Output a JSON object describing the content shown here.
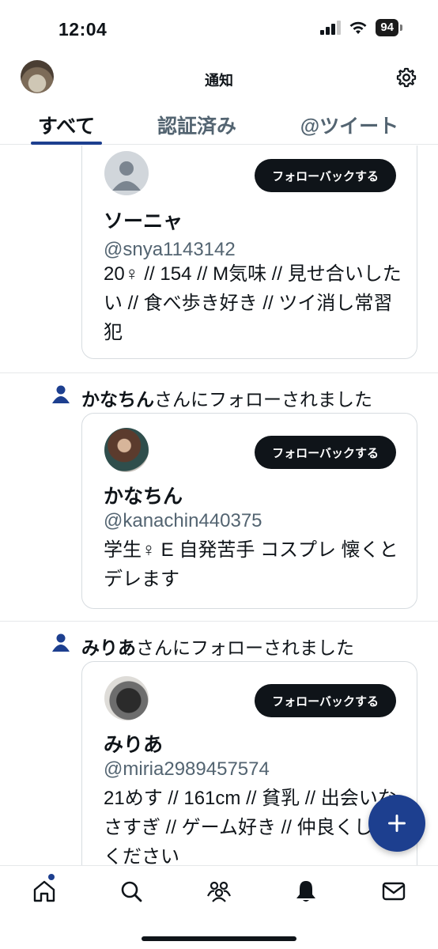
{
  "status_bar": {
    "time": "12:04",
    "battery": "94"
  },
  "header": {
    "title": "通知",
    "avatar_icon": "profile-avatar",
    "settings_icon": "gear-icon"
  },
  "tabs": [
    {
      "label": "すべて",
      "active": true
    },
    {
      "label": "認証済み",
      "active": false
    },
    {
      "label": "@ツイート",
      "active": false
    }
  ],
  "notifications": [
    {
      "text_name": "",
      "text_suffix": "",
      "card": {
        "name": "ソーニャ",
        "handle": "@snya1143142",
        "bio": "20♀ // 154 // M気味 // 見せ合いしたい // 食べ歩き好き // ツイ消し常習犯",
        "button": "フォローバックする",
        "avatar": "default-avatar"
      }
    },
    {
      "text_name": "かなちん",
      "text_suffix": "さんにフォローされました",
      "card": {
        "name": "かなちん",
        "handle": "@kanachin440375",
        "bio": "学生♀ E 自発苦手 コスプレ 懐くとデレます",
        "button": "フォローバックする",
        "avatar": "photo-avatar"
      }
    },
    {
      "text_name": "みりあ",
      "text_suffix": "さんにフォローされました",
      "card": {
        "name": "みりあ",
        "handle": "@miria2989457574",
        "bio": "21めす // 161cm // 貧乳 // 出会いなさすぎ // ゲーム好き // 仲良くしてください",
        "button": "フォローバックする",
        "avatar": "photo-avatar"
      }
    }
  ],
  "fab": {
    "icon": "plus-icon"
  },
  "bottom_nav": [
    "home-icon",
    "search-icon",
    "communities-icon",
    "notifications-bell-icon",
    "messages-icon"
  ],
  "colors": {
    "accent": "#1d3f8f",
    "text": "#0f1419",
    "secondary": "#536471",
    "button_bg": "#0f1419"
  }
}
